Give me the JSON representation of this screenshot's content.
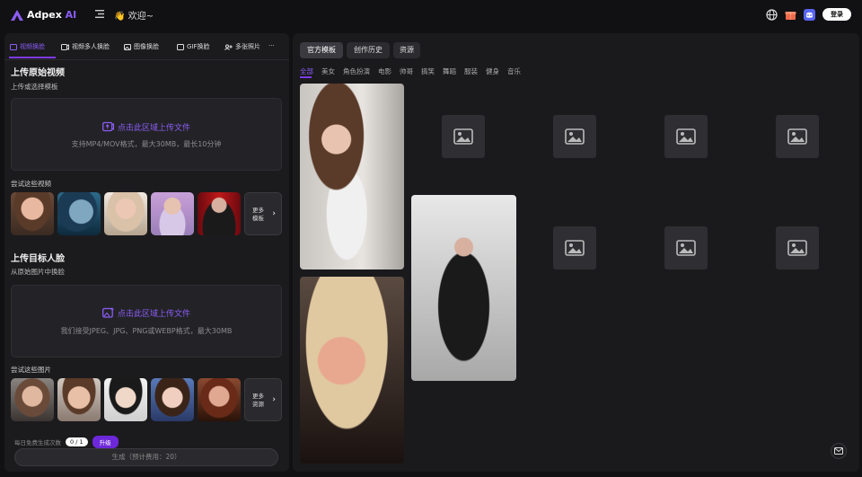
{
  "header": {
    "logo_main": "Adpex",
    "logo_ai": "AI",
    "welcome": "👋 欢迎~",
    "login_label": "登录",
    "icons": [
      "globe-icon",
      "gift-icon",
      "discord-icon"
    ]
  },
  "left": {
    "tabs": [
      {
        "label": "视频换脸",
        "icon": "video-icon"
      },
      {
        "label": "视频多人换脸",
        "icon": "multi-video-icon"
      },
      {
        "label": "图像换脸",
        "icon": "image-icon"
      },
      {
        "label": "GIF换脸",
        "icon": "gif-icon"
      },
      {
        "label": "多张照片",
        "icon": "multi-photo-icon"
      },
      {
        "label": "···",
        "icon": "more-icon"
      }
    ],
    "source": {
      "title": "上传原始视频",
      "subtitle": "上传或选择模板",
      "upload_label": "点击此区域上传文件",
      "upload_desc": "支持MP4/MOV格式，最大30MB，最长10分钟",
      "try_label": "尝试这些视频",
      "more_label_1": "更多",
      "more_label_2": "模板"
    },
    "target": {
      "title": "上传目标人脸",
      "subtitle": "从原始图片中换脸",
      "upload_label": "点击此区域上传文件",
      "upload_desc": "我们接受JPEG、JPG、PNG或WEBP格式，最大30MB",
      "try_label": "尝试这些图片",
      "more_label_1": "更多",
      "more_label_2": "资源"
    },
    "quota": {
      "label": "每日免费生成次数",
      "value": "0 / 1",
      "upgrade": "升级"
    },
    "generate_label": "生成（预计费用：20）"
  },
  "right": {
    "tabs": [
      "官方模板",
      "创作历史",
      "资源"
    ],
    "categories": [
      "全部",
      "美女",
      "角色扮演",
      "电影",
      "帅哥",
      "搞笑",
      "舞蹈",
      "服装",
      "健身",
      "音乐"
    ]
  },
  "colors": {
    "accent": "#7c3aed",
    "bg": "#111113",
    "panel": "#1b1b1d"
  }
}
